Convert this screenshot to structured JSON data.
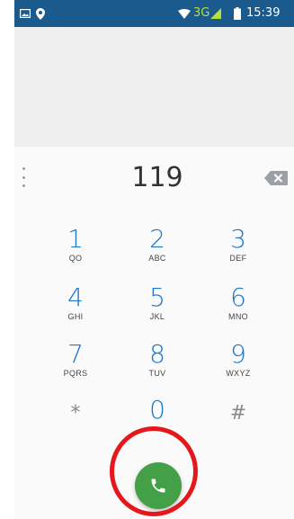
{
  "status_bar": {
    "left_icons": [
      "image-icon",
      "location-pin-icon"
    ],
    "network_type": "3G",
    "time": "15:39",
    "right_icons": [
      "wifi-icon",
      "signal-icon",
      "battery-icon"
    ]
  },
  "dialer": {
    "entered_number": "119",
    "keys": [
      {
        "digit": "1",
        "letters": "QO"
      },
      {
        "digit": "2",
        "letters": "ABC"
      },
      {
        "digit": "3",
        "letters": "DEF"
      },
      {
        "digit": "4",
        "letters": "GHI"
      },
      {
        "digit": "5",
        "letters": "JKL"
      },
      {
        "digit": "6",
        "letters": "MNO"
      },
      {
        "digit": "7",
        "letters": "PQRS"
      },
      {
        "digit": "8",
        "letters": "TUV"
      },
      {
        "digit": "9",
        "letters": "WXYZ"
      },
      {
        "digit": "*",
        "letters": ""
      },
      {
        "digit": "0",
        "letters": "+"
      },
      {
        "digit": "#",
        "letters": ""
      }
    ],
    "call_button_icon": "phone-icon",
    "backspace_icon": "backspace-icon",
    "menu_icon": "overflow-menu-icon"
  },
  "colors": {
    "status_bar": "#1b5a8c",
    "digit": "#1f77c8",
    "call_button": "#43a047",
    "highlight_ring": "#e4181c"
  }
}
